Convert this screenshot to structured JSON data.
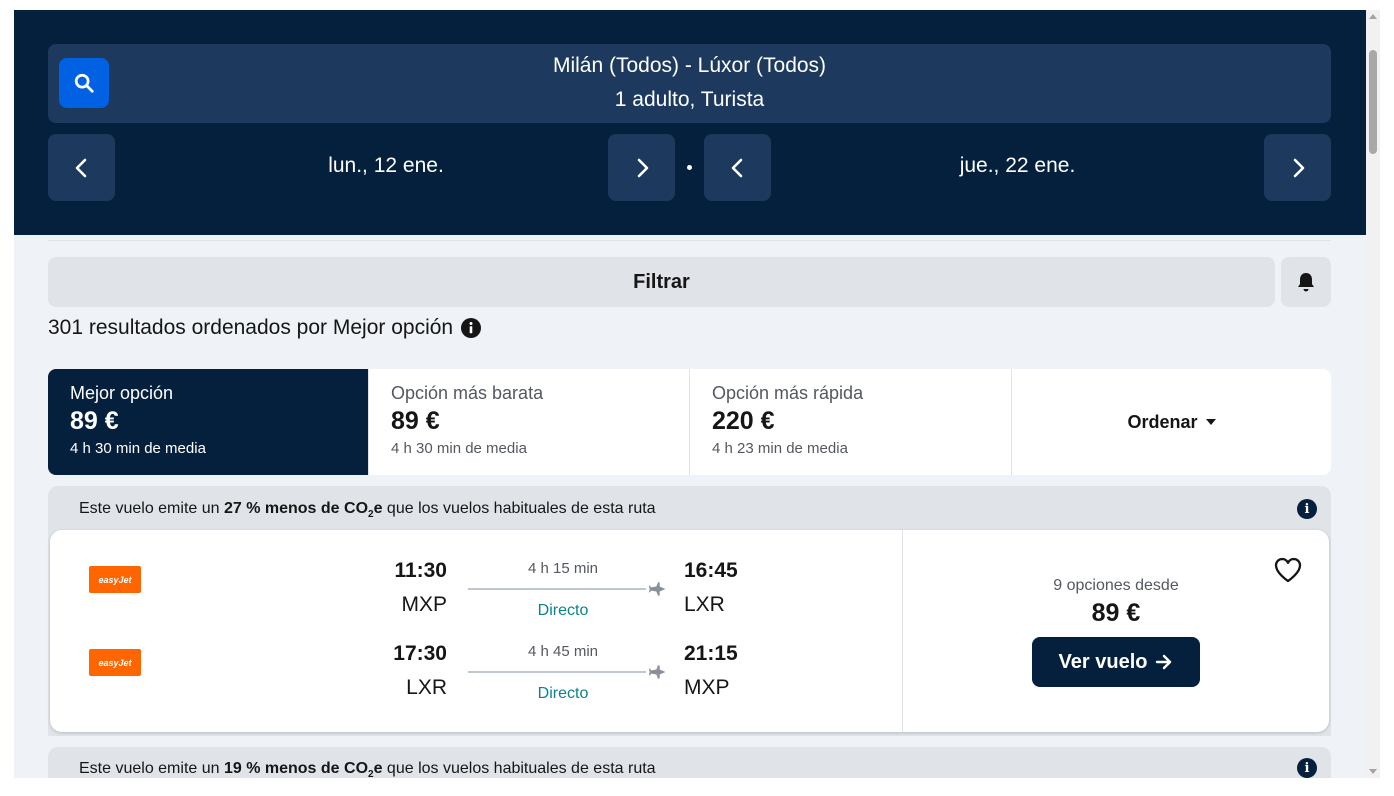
{
  "header": {
    "route": "Milán (Todos) - Lúxor (Todos)",
    "passengers": "1 adulto, Turista",
    "depart_date": "lun., 12 ene.",
    "return_date": "jue., 22 ene."
  },
  "filter": {
    "label": "Filtrar"
  },
  "results": {
    "summary": "301 resultados ordenados por Mejor opción"
  },
  "sort_tabs": [
    {
      "label": "Mejor opción",
      "price": "89 €",
      "sub": "4 h 30 min de media"
    },
    {
      "label": "Opción más barata",
      "price": "89 €",
      "sub": "4 h 30 min de media"
    },
    {
      "label": "Opción más rápida",
      "price": "220 €",
      "sub": "4 h 23 min de media"
    }
  ],
  "sort_dropdown": {
    "label": "Ordenar"
  },
  "result_cards": [
    {
      "eco": {
        "prefix": "Este vuelo emite un ",
        "highlight": "27 % menos de CO",
        "sub": "2",
        "highlight_end": "e",
        "suffix": " que los vuelos habituales de esta ruta"
      },
      "legs": [
        {
          "airline": "easyJet",
          "dep_time": "11:30",
          "dep_code": "MXP",
          "duration": "4 h 15 min",
          "stops": "Directo",
          "arr_time": "16:45",
          "arr_code": "LXR"
        },
        {
          "airline": "easyJet",
          "dep_time": "17:30",
          "dep_code": "LXR",
          "duration": "4 h 45 min",
          "stops": "Directo",
          "arr_time": "21:15",
          "arr_code": "MXP"
        }
      ],
      "options": "9 opciones desde",
      "price": "89 €",
      "cta": "Ver vuelo"
    },
    {
      "eco": {
        "prefix": "Este vuelo emite un ",
        "highlight": "19 % menos de CO",
        "sub": "2",
        "highlight_end": "e",
        "suffix": " que los vuelos habituales de esta ruta"
      }
    }
  ],
  "icons": {
    "search": "search-icon",
    "chevron_left": "chevron-left-icon",
    "chevron_right": "chevron-right-icon",
    "bell": "bell-icon",
    "info": "info-icon",
    "plane": "plane-icon",
    "heart": "heart-icon",
    "arrow_right": "arrow-right-icon",
    "caret_down": "caret-down-icon"
  },
  "colors": {
    "header_bg": "#05203c",
    "header_box": "#1d3a5e",
    "search_btn": "#0062e3",
    "direct": "#0c838a",
    "easyjet": "#ff6600"
  }
}
